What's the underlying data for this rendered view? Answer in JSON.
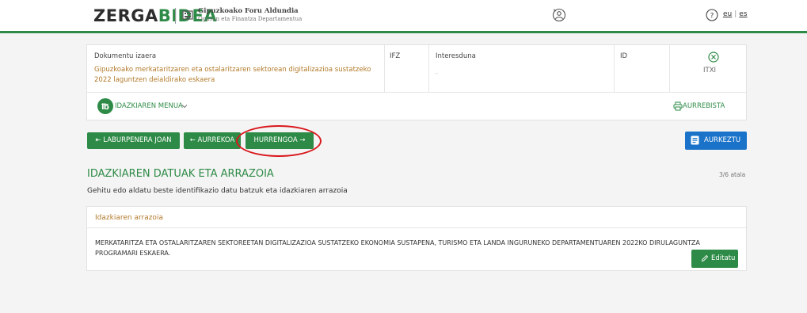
{
  "header": {
    "logo_a": "ZERGA",
    "logo_b": "BIDEA",
    "org_line1": "Gipuzkoako Foru Aldundia",
    "org_line2": "Ogasun eta Finantza Departamentua",
    "lang_eu": "eu",
    "lang_es": "es",
    "lang_sep": "|"
  },
  "document": {
    "type_label": "Dokumentu izaera",
    "type_value": "Gipuzkoako merkataritzaren eta ostalaritzaren sektorean digitalizazioa sustatzeko 2022 laguntzen deialdirako eskaera",
    "ifz_label": "IFZ",
    "interested_label": "Interesduna",
    "interested_value": "-",
    "id_label": "ID",
    "close_label": "ITXI",
    "menu_label": "IDAZKIAREN MENUA",
    "preview_label": "AURREBISTA"
  },
  "nav": {
    "first_label": "⇤ LABURPENERA JOAN",
    "prev_label": "← AURREKOA",
    "next_label": "HURRENGOA →",
    "submit_label": "AURKEZTU"
  },
  "section": {
    "title": "IDAZKIAREN DATUAK ETA ARRAZOIA",
    "subtitle": "Gehitu edo aldatu beste identifikazio datu batzuk eta idazkiaren arrazoia",
    "step": "3/6 atala"
  },
  "reason": {
    "title": "Idazkiaren arrazoia",
    "text": "MERKATARITZA ETA OSTALARITZAREN SEKTOREETAN DIGITALIZAZIOA SUSTATZEKO EKONOMIA SUSTAPENA, TURISMO ETA LANDA INGURUNEKO DEPARTAMENTUAREN 2022KO DIRULAGUNTZA PROGRAMARI ESKAERA.",
    "edit_label": "Editatu"
  },
  "colors": {
    "brand_green": "#2e8b47",
    "accent_gold": "#b27a2a",
    "submit_blue": "#1a73c9",
    "highlight_red": "#d9171c"
  },
  "icons": [
    "building-icon",
    "user-icon",
    "help-icon",
    "close-icon",
    "menu-badge-icon",
    "chevron-down-icon",
    "printer-icon",
    "submit-icon",
    "pencil-icon"
  ]
}
